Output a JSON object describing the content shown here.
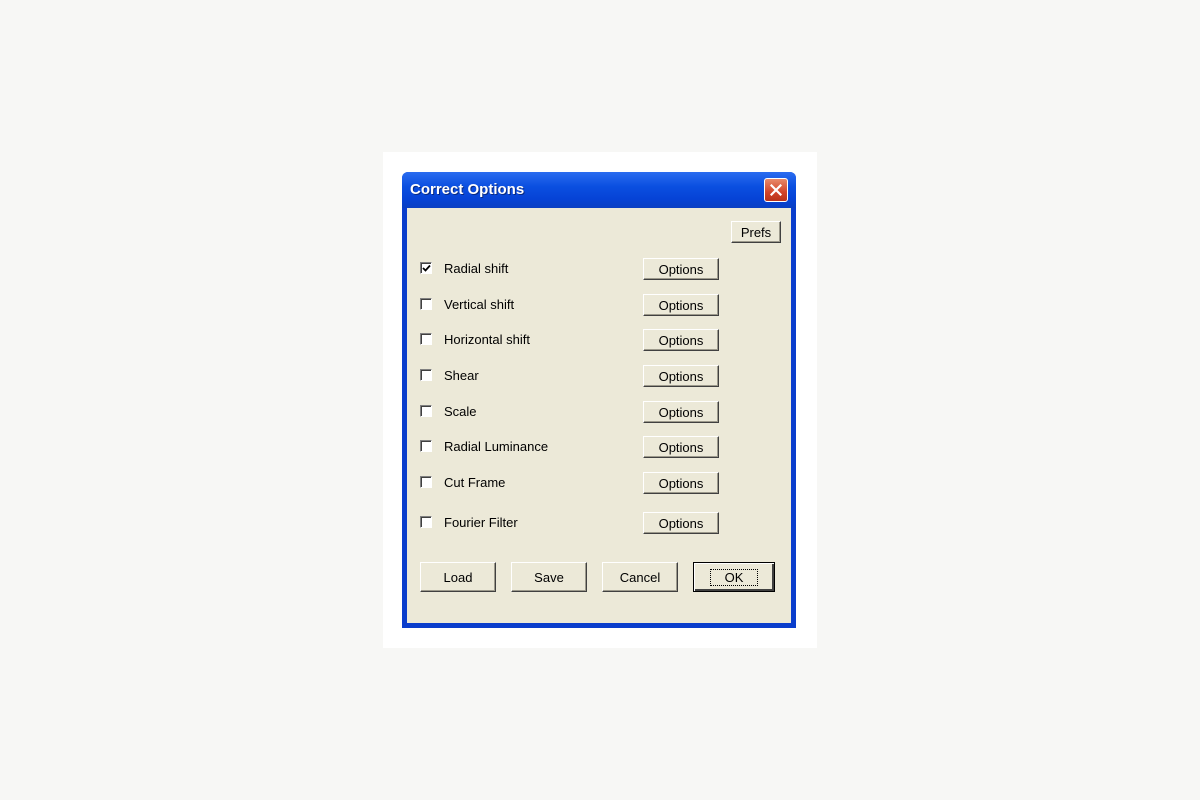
{
  "window": {
    "title": "Correct Options",
    "close_icon": "close-icon"
  },
  "prefs_label": "Prefs",
  "options": [
    {
      "label": "Radial shift",
      "checked": true,
      "button": "Options"
    },
    {
      "label": "Vertical shift",
      "checked": false,
      "button": "Options"
    },
    {
      "label": "Horizontal shift",
      "checked": false,
      "button": "Options"
    },
    {
      "label": "Shear",
      "checked": false,
      "button": "Options"
    },
    {
      "label": "Scale",
      "checked": false,
      "button": "Options"
    },
    {
      "label": "Radial Luminance",
      "checked": false,
      "button": "Options"
    },
    {
      "label": "Cut Frame",
      "checked": false,
      "button": "Options"
    },
    {
      "label": "Fourier Filter",
      "checked": false,
      "button": "Options"
    }
  ],
  "footer": {
    "load": "Load",
    "save": "Save",
    "cancel": "Cancel",
    "ok": "OK"
  },
  "colors": {
    "titlebar": "#0b4fe0",
    "client_bg": "#ece9d8",
    "close_button": "#d2452a"
  }
}
